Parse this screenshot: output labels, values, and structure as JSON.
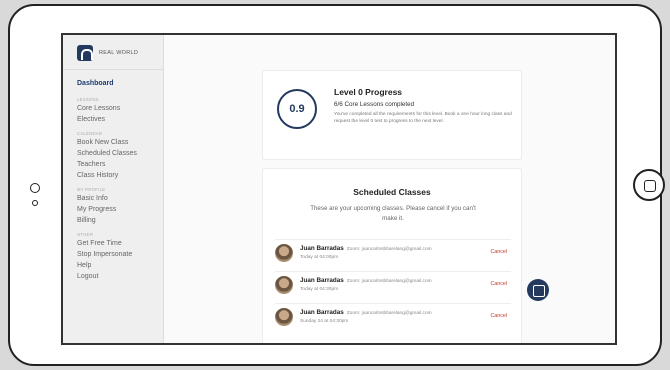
{
  "sidebar": {
    "logo_text": "REAL WORLD",
    "dashboard": "Dashboard",
    "lessons": {
      "heading": "LESSONS",
      "items": [
        "Core Lessons",
        "Electives"
      ]
    },
    "calendar": {
      "heading": "CALENDAR",
      "items": [
        "Book New Class",
        "Scheduled Classes",
        "Teachers",
        "Class History"
      ]
    },
    "profile": {
      "heading": "MY PROFILE",
      "items": [
        "Basic Info",
        "My Progress",
        "Billing"
      ]
    },
    "other": {
      "heading": "OTHER",
      "items": [
        "Get Free Time",
        "Stop Impersonate",
        "Help",
        "Logout"
      ]
    }
  },
  "progress": {
    "score": "0.9",
    "title": "Level 0 Progress",
    "subtitle": "6/6 Core Lessons completed",
    "description": "You've completed all the requirements for this level. Book a one hour long class and request the level 0 test to progress to the next level."
  },
  "scheduled": {
    "title": "Scheduled Classes",
    "subtitle": "These are your upcoming classes. Please cancel if you can't make it.",
    "cancel_label": "Cancel",
    "classes": [
      {
        "teacher": "Juan Barradas",
        "meta": "Zoom: juancarlosbbarelang@gmail.com",
        "when": "Today at 04:00pm"
      },
      {
        "teacher": "Juan Barradas",
        "meta": "Zoom: juancarlosbbarelang@gmail.com",
        "when": "Today at 04:30pm"
      },
      {
        "teacher": "Juan Barradas",
        "meta": "Zoom: juancarlosbbarelang@gmail.com",
        "when": "Sunday 24 at 04:30pm"
      }
    ]
  }
}
